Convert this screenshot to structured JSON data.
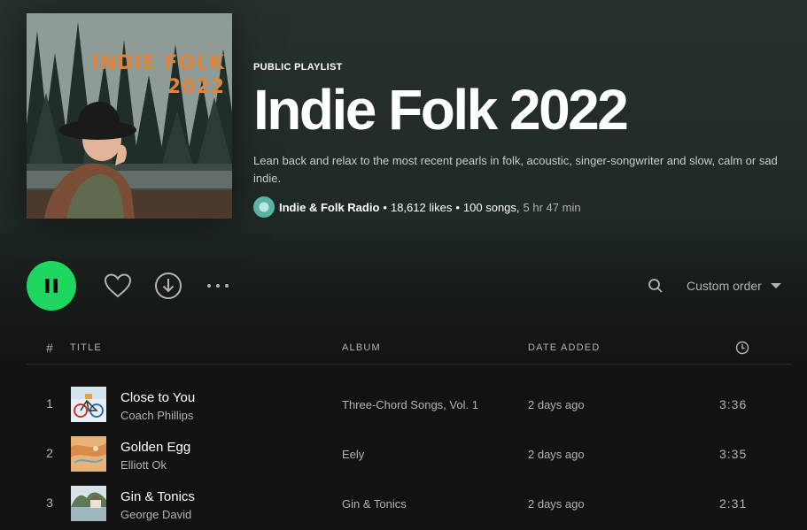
{
  "header": {
    "cover_text_line1": "INDIE FOLK",
    "cover_text_line2": "2022",
    "kind": "PUBLIC PLAYLIST",
    "title": "Indie Folk 2022",
    "description": "Lean back and relax to the most recent pearls in folk, acoustic, singer-songwriter and slow, calm or sad indie.",
    "owner": "Indie & Folk Radio",
    "likes": "18,612 likes",
    "songs": "100 songs,",
    "duration": "5 hr 47 min",
    "separator": "•"
  },
  "actions": {
    "play_icon": "pause-icon",
    "like_icon": "heart-icon",
    "download_icon": "download-icon",
    "more_icon": "more-icon",
    "search_icon": "search-icon",
    "sort_label": "Custom order",
    "accent_color": "#1ed760"
  },
  "table": {
    "headers": {
      "num": "#",
      "title": "TITLE",
      "album": "ALBUM",
      "date": "DATE ADDED",
      "duration_icon": "clock-icon"
    },
    "rows": [
      {
        "num": "1",
        "name": "Close to You",
        "artist": "Coach Phillips",
        "album": "Three-Chord Songs, Vol. 1",
        "date": "2 days ago",
        "duration": "3:36"
      },
      {
        "num": "2",
        "name": "Golden Egg",
        "artist": "Elliott Ok",
        "album": "Eely",
        "date": "2 days ago",
        "duration": "3:35"
      },
      {
        "num": "3",
        "name": "Gin & Tonics",
        "artist": "George David",
        "album": "Gin & Tonics",
        "date": "2 days ago",
        "duration": "2:31"
      }
    ]
  }
}
